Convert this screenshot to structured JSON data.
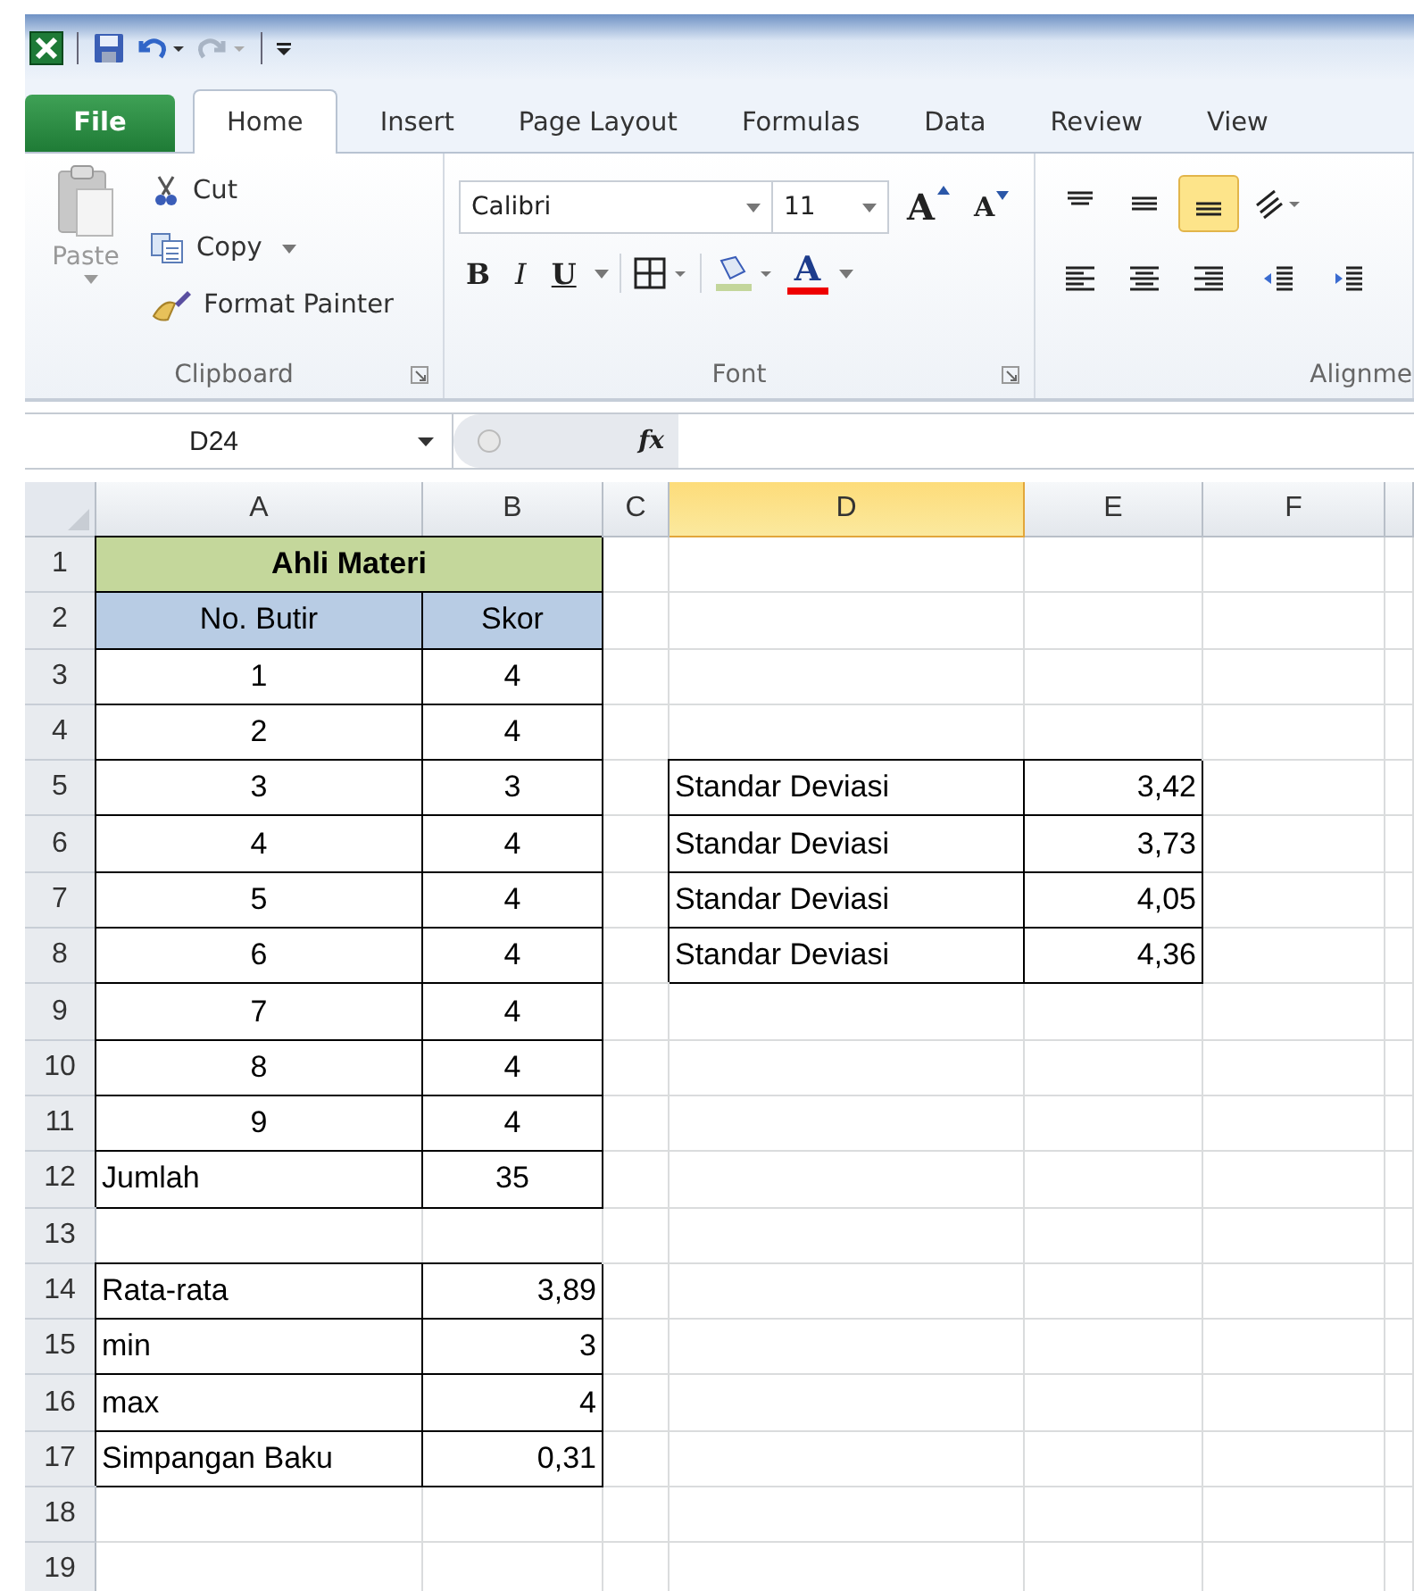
{
  "quick_access": {
    "redo": {
      "disabled": true
    }
  },
  "tabs": [
    {
      "label": "File",
      "kind": "file",
      "selected": false
    },
    {
      "label": "Home",
      "kind": "tab",
      "selected": true
    },
    {
      "label": "Insert",
      "kind": "tab",
      "selected": false
    },
    {
      "label": "Page Layout",
      "kind": "tab",
      "selected": false
    },
    {
      "label": "Formulas",
      "kind": "tab",
      "selected": false
    },
    {
      "label": "Data",
      "kind": "tab",
      "selected": false
    },
    {
      "label": "Review",
      "kind": "tab",
      "selected": false
    },
    {
      "label": "View",
      "kind": "tab",
      "selected": false
    }
  ],
  "clipboard": {
    "label": "Clipboard",
    "paste": {
      "label": "Paste",
      "disabled": true
    },
    "cut": "Cut",
    "copy": "Copy",
    "format_painter": "Format Painter"
  },
  "font": {
    "label": "Font",
    "font_name": "Calibri",
    "font_size": "11",
    "grow": "A",
    "shrink": "A",
    "bold": "B",
    "italic": "I",
    "underline": "U",
    "font_color": "A"
  },
  "alignment": {
    "label": "Alignme",
    "buttons": [
      {
        "kind": "top",
        "selected": false
      },
      {
        "kind": "middle",
        "selected": false
      },
      {
        "kind": "bottom",
        "selected": true
      },
      {
        "kind": "orientation",
        "selected": false
      },
      {
        "kind": "left",
        "selected": false
      },
      {
        "kind": "center",
        "selected": false
      },
      {
        "kind": "right",
        "selected": false
      },
      {
        "kind": "outdent",
        "selected": false
      },
      {
        "kind": "indent",
        "selected": false
      }
    ]
  },
  "formula_bar": {
    "name_box": "D24",
    "function_label": "fx"
  },
  "columns": [
    {
      "label": "A",
      "selected": false
    },
    {
      "label": "B",
      "selected": false
    },
    {
      "label": "C",
      "selected": false
    },
    {
      "label": "D",
      "selected": true
    },
    {
      "label": "E",
      "selected": false
    },
    {
      "label": "F",
      "selected": false
    }
  ],
  "rows": [
    {
      "label": "1",
      "cells": [
        {
          "text": "Ahli Materi",
          "kind": "title"
        },
        {
          "kind": "empty"
        },
        {
          "kind": "empty"
        },
        {
          "kind": "empty"
        },
        {
          "kind": "empty"
        }
      ]
    },
    {
      "label": "2",
      "cells": [
        {
          "text": "No. Butir",
          "kind": "header"
        },
        {
          "text": "Skor",
          "kind": "header"
        },
        {
          "kind": "empty"
        },
        {
          "kind": "empty"
        },
        {
          "kind": "empty"
        },
        {
          "kind": "empty"
        }
      ]
    },
    {
      "label": "3",
      "cells": [
        {
          "text": "1",
          "kind": "center"
        },
        {
          "text": "4",
          "kind": "center"
        },
        {
          "kind": "empty"
        },
        {
          "kind": "empty"
        },
        {
          "kind": "empty"
        },
        {
          "kind": "empty"
        }
      ]
    },
    {
      "label": "4",
      "cells": [
        {
          "text": "2",
          "kind": "center"
        },
        {
          "text": "4",
          "kind": "center"
        },
        {
          "kind": "empty"
        },
        {
          "kind": "empty"
        },
        {
          "kind": "empty"
        },
        {
          "kind": "empty"
        }
      ]
    },
    {
      "label": "5",
      "cells": [
        {
          "text": "3",
          "kind": "center"
        },
        {
          "text": "3",
          "kind": "center"
        },
        {
          "kind": "empty"
        },
        {
          "text": "Standar Deviasi",
          "kind": "left"
        },
        {
          "text": "3,42",
          "kind": "right"
        },
        {
          "kind": "empty"
        }
      ]
    },
    {
      "label": "6",
      "cells": [
        {
          "text": "4",
          "kind": "center"
        },
        {
          "text": "4",
          "kind": "center"
        },
        {
          "kind": "empty"
        },
        {
          "text": "Standar Deviasi",
          "kind": "left"
        },
        {
          "text": "3,73",
          "kind": "right"
        },
        {
          "kind": "empty"
        }
      ]
    },
    {
      "label": "7",
      "cells": [
        {
          "text": "5",
          "kind": "center"
        },
        {
          "text": "4",
          "kind": "center"
        },
        {
          "kind": "empty"
        },
        {
          "text": "Standar Deviasi",
          "kind": "left"
        },
        {
          "text": "4,05",
          "kind": "right"
        },
        {
          "kind": "empty"
        }
      ]
    },
    {
      "label": "8",
      "cells": [
        {
          "text": "6",
          "kind": "center"
        },
        {
          "text": "4",
          "kind": "center"
        },
        {
          "kind": "empty"
        },
        {
          "text": "Standar Deviasi",
          "kind": "left"
        },
        {
          "text": "4,36",
          "kind": "right"
        },
        {
          "kind": "empty"
        }
      ]
    },
    {
      "label": "9",
      "cells": [
        {
          "text": "7",
          "kind": "center"
        },
        {
          "text": "4",
          "kind": "center"
        },
        {
          "kind": "empty"
        },
        {
          "kind": "empty"
        },
        {
          "kind": "empty"
        },
        {
          "kind": "empty"
        }
      ]
    },
    {
      "label": "10",
      "cells": [
        {
          "text": "8",
          "kind": "center"
        },
        {
          "text": "4",
          "kind": "center"
        },
        {
          "kind": "empty"
        },
        {
          "kind": "empty"
        },
        {
          "kind": "empty"
        },
        {
          "kind": "empty"
        }
      ]
    },
    {
      "label": "11",
      "cells": [
        {
          "text": "9",
          "kind": "center"
        },
        {
          "text": "4",
          "kind": "center"
        },
        {
          "kind": "empty"
        },
        {
          "kind": "empty"
        },
        {
          "kind": "empty"
        },
        {
          "kind": "empty"
        }
      ]
    },
    {
      "label": "12",
      "cells": [
        {
          "text": "Jumlah",
          "kind": "left"
        },
        {
          "text": "35",
          "kind": "center"
        },
        {
          "kind": "empty"
        },
        {
          "kind": "empty"
        },
        {
          "kind": "empty"
        },
        {
          "kind": "empty"
        }
      ]
    },
    {
      "label": "13",
      "cells": [
        {
          "kind": "empty"
        },
        {
          "kind": "empty"
        },
        {
          "kind": "empty"
        },
        {
          "kind": "empty"
        },
        {
          "kind": "empty"
        },
        {
          "kind": "empty"
        }
      ]
    },
    {
      "label": "14",
      "cells": [
        {
          "text": "Rata-rata",
          "kind": "left"
        },
        {
          "text": "3,89",
          "kind": "right"
        },
        {
          "kind": "empty"
        },
        {
          "kind": "empty"
        },
        {
          "kind": "empty"
        },
        {
          "kind": "empty"
        }
      ]
    },
    {
      "label": "15",
      "cells": [
        {
          "text": "min",
          "kind": "left"
        },
        {
          "text": "3",
          "kind": "right"
        },
        {
          "kind": "empty"
        },
        {
          "kind": "empty"
        },
        {
          "kind": "empty"
        },
        {
          "kind": "empty"
        }
      ]
    },
    {
      "label": "16",
      "cells": [
        {
          "text": "max",
          "kind": "left"
        },
        {
          "text": "4",
          "kind": "right"
        },
        {
          "kind": "empty"
        },
        {
          "kind": "empty"
        },
        {
          "kind": "empty"
        },
        {
          "kind": "empty"
        }
      ]
    },
    {
      "label": "17",
      "cells": [
        {
          "text": "Simpangan Baku",
          "kind": "left"
        },
        {
          "text": "0,31",
          "kind": "right"
        },
        {
          "kind": "empty"
        },
        {
          "kind": "empty"
        },
        {
          "kind": "empty"
        },
        {
          "kind": "empty"
        }
      ]
    },
    {
      "label": "18",
      "cells": [
        {
          "kind": "empty"
        },
        {
          "kind": "empty"
        },
        {
          "kind": "empty"
        },
        {
          "kind": "empty"
        },
        {
          "kind": "empty"
        },
        {
          "kind": "empty"
        }
      ]
    },
    {
      "label": "19",
      "cells": [
        {
          "kind": "empty"
        },
        {
          "kind": "empty"
        },
        {
          "kind": "empty"
        },
        {
          "kind": "empty"
        },
        {
          "kind": "empty"
        },
        {
          "kind": "empty"
        }
      ]
    }
  ]
}
